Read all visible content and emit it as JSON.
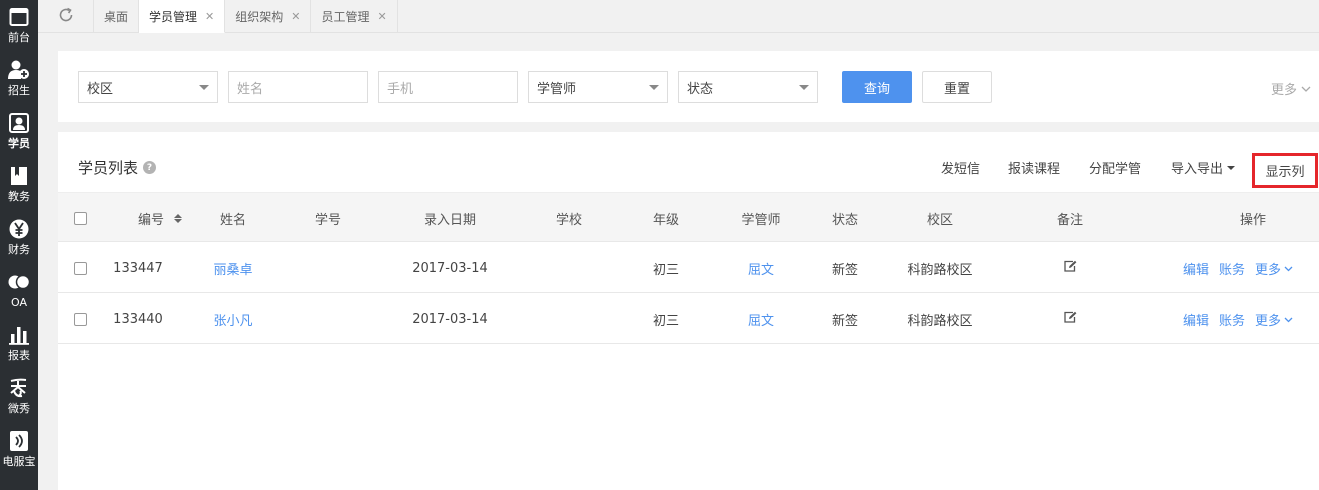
{
  "sidebar": {
    "items": [
      {
        "label": "前台",
        "icon": "window-icon"
      },
      {
        "label": "招生",
        "icon": "add-user-icon"
      },
      {
        "label": "学员",
        "icon": "student-icon",
        "active": true
      },
      {
        "label": "教务",
        "icon": "book-icon"
      },
      {
        "label": "财务",
        "icon": "yen-icon"
      },
      {
        "label": "OA",
        "icon": "oa-icon"
      },
      {
        "label": "报表",
        "icon": "bar-chart-icon"
      },
      {
        "label": "微秀",
        "icon": "xiu-icon"
      },
      {
        "label": "电服宝",
        "icon": "speaker-icon"
      }
    ]
  },
  "tabs": [
    {
      "label": "桌面",
      "closable": false
    },
    {
      "label": "学员管理",
      "closable": true,
      "active": true
    },
    {
      "label": "组织架构",
      "closable": true
    },
    {
      "label": "员工管理",
      "closable": true
    }
  ],
  "tab_close_glyph": "✕",
  "filters": {
    "campus": "校区",
    "name_placeholder": "姓名",
    "phone_placeholder": "手机",
    "manager": "学管师",
    "status": "状态",
    "query_button": "查询",
    "reset_button": "重置",
    "more": "更多"
  },
  "list": {
    "title": "学员列表",
    "help": "?",
    "actions": {
      "sms": "发短信",
      "enroll": "报读课程",
      "assign": "分配学管",
      "import_export": "导入导出",
      "show_columns": "显示列"
    },
    "columns": [
      "编号",
      "姓名",
      "学号",
      "录入日期",
      "学校",
      "年级",
      "学管师",
      "状态",
      "校区",
      "备注",
      "操作"
    ],
    "rows": [
      {
        "id": "133447",
        "name": "丽桑卓",
        "student_no": "",
        "date": "2017-03-14",
        "school": "",
        "grade": "初三",
        "manager": "屈文",
        "status": "新签",
        "campus": "科韵路校区",
        "edit": "编辑",
        "account": "账务",
        "more": "更多"
      },
      {
        "id": "133440",
        "name": "张小凡",
        "student_no": "",
        "date": "2017-03-14",
        "school": "",
        "grade": "初三",
        "manager": "屈文",
        "status": "新签",
        "campus": "科韵路校区",
        "edit": "编辑",
        "account": "账务",
        "more": "更多"
      }
    ]
  },
  "colors": {
    "sidebar_bg": "#2b2f33",
    "primary": "#4e92ee",
    "link": "#4e92ee",
    "highlight_border": "#e5262b"
  }
}
